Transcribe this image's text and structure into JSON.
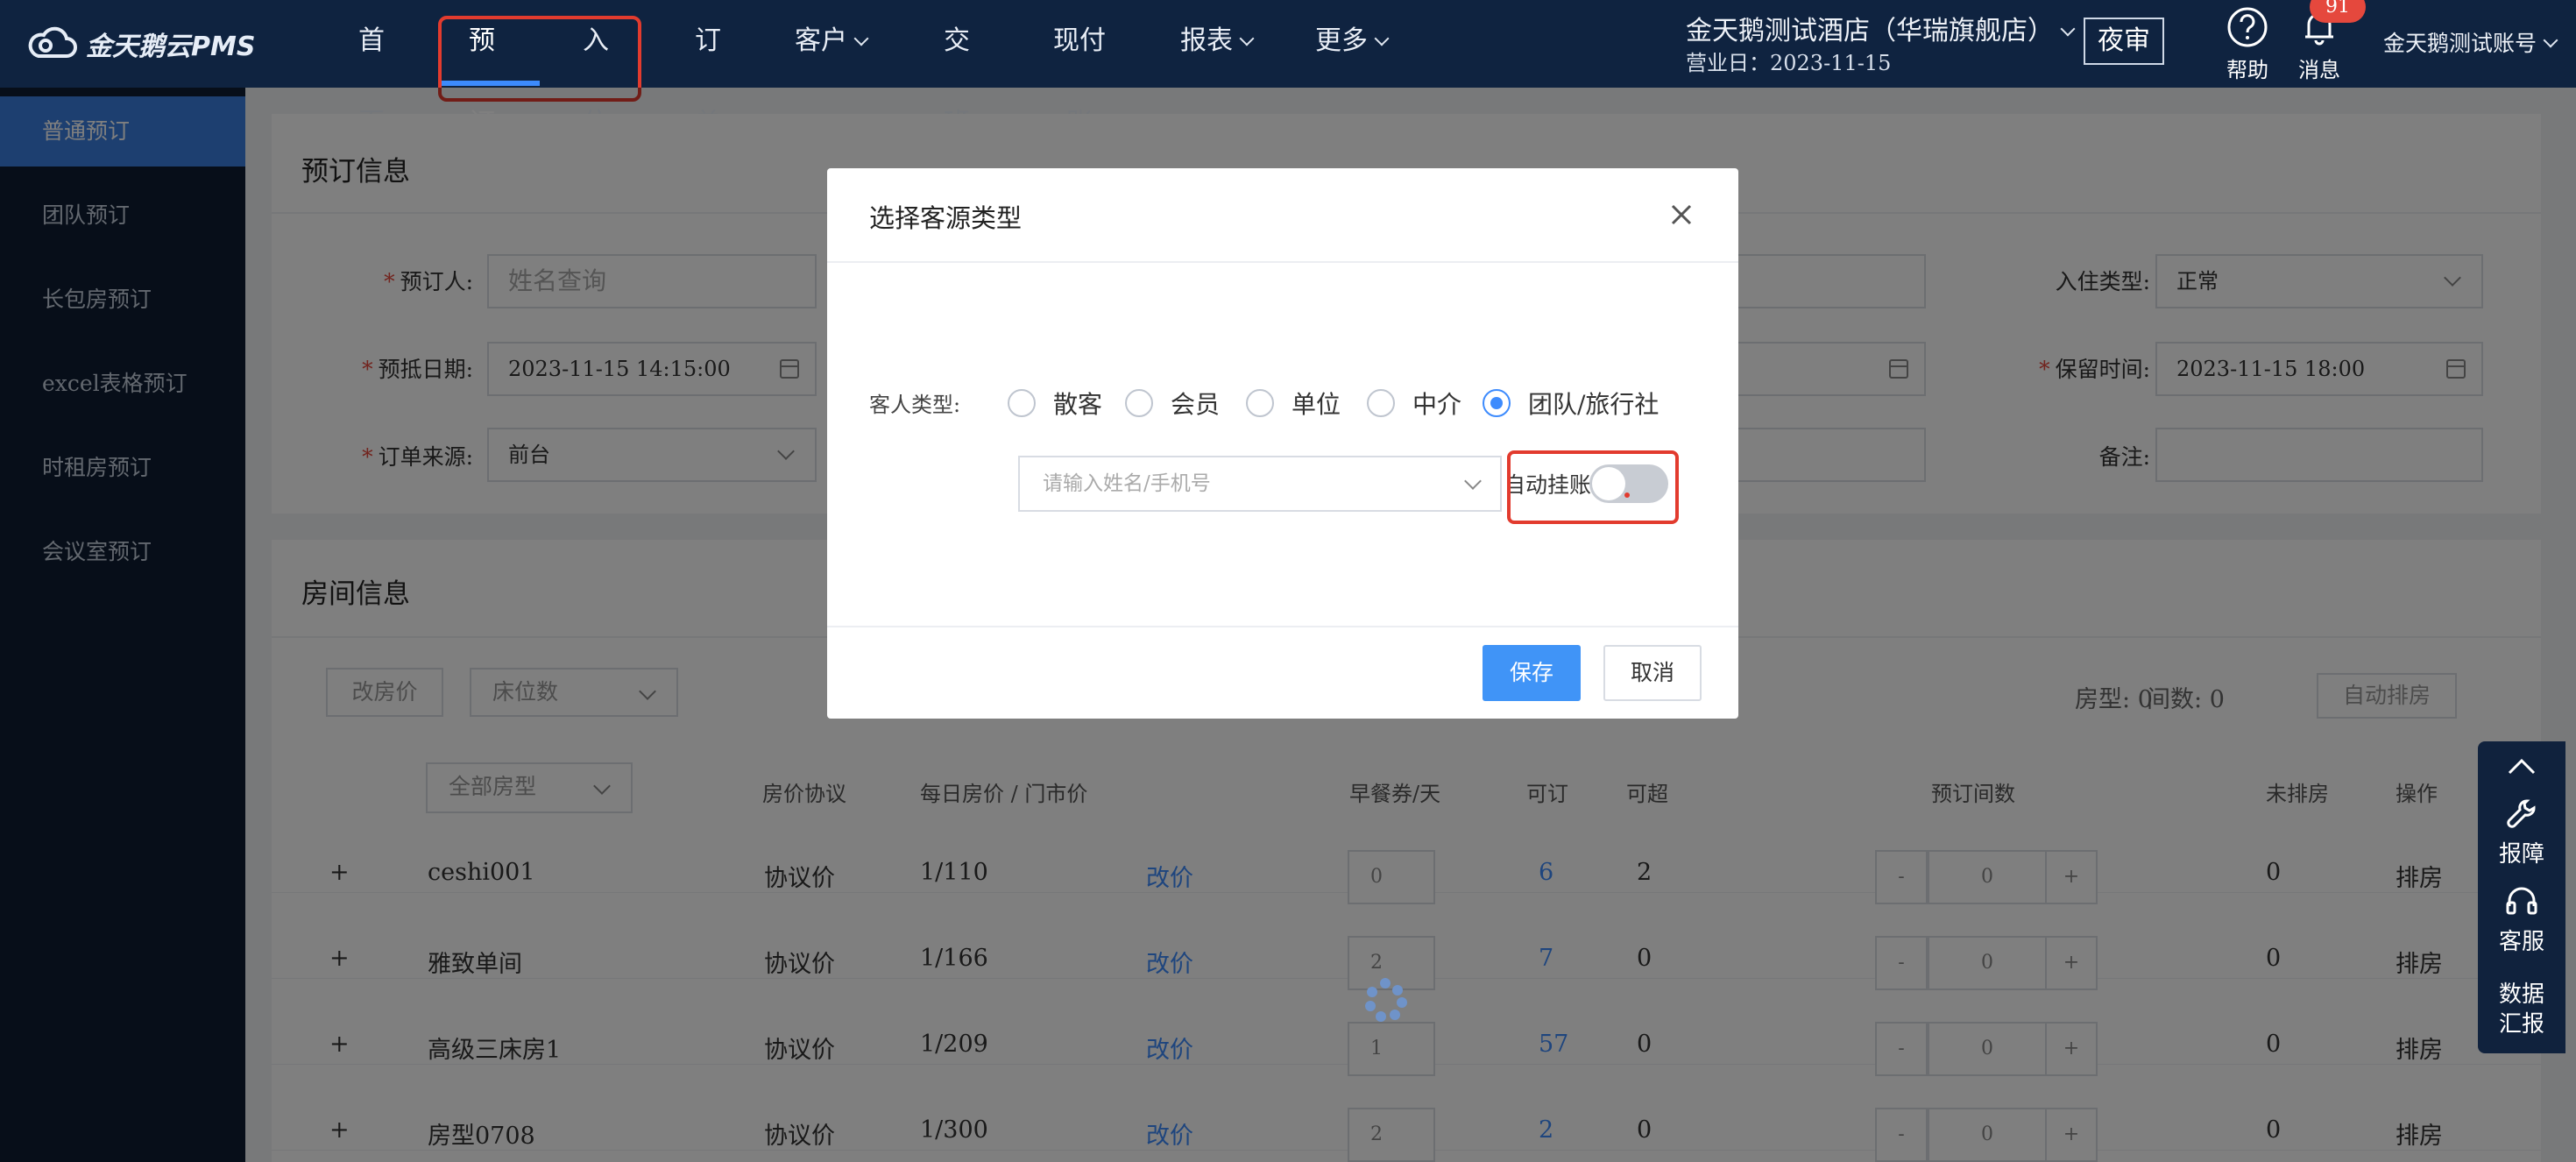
{
  "app": {
    "name": "金天鹅云PMS"
  },
  "nav": {
    "items": [
      {
        "label": "首页"
      },
      {
        "label": "预订"
      },
      {
        "label": "入住"
      },
      {
        "label": "订单"
      },
      {
        "label": "客户"
      },
      {
        "label": "交班"
      },
      {
        "label": "现付账"
      },
      {
        "label": "报表"
      },
      {
        "label": "更多"
      }
    ]
  },
  "header": {
    "hotel": "金天鹅测试酒店（华瑞旗舰店）",
    "business_day": "营业日：2023-11-15",
    "night_audit": "夜审",
    "help": "帮助",
    "messages": "消息",
    "message_count": "91",
    "account": "金天鹅测试账号"
  },
  "sidebar": {
    "items": [
      {
        "label": "普通预订"
      },
      {
        "label": "团队预订"
      },
      {
        "label": "长包房预订"
      },
      {
        "label": "excel表格预订"
      },
      {
        "label": "时租房预订"
      },
      {
        "label": "会议室预订"
      }
    ]
  },
  "booking": {
    "title": "预订信息",
    "booker_label": "预订人:",
    "booker_placeholder": "姓名查询",
    "arrival_label": "预抵日期:",
    "arrival_value": "2023-11-15 14:15:00",
    "source_label": "订单来源:",
    "source_value": "前台",
    "checkin_type_label": "入住类型:",
    "checkin_type_value": "正常",
    "hold_time_label": "保留时间:",
    "hold_time_value": "2023-11-15 18:00",
    "remark_label": "备注:"
  },
  "rooms": {
    "title": "房间信息",
    "change_price": "改房价",
    "bed_count": "床位数",
    "room_type_label": "房型:",
    "room_type_count": "0",
    "room_count_label": "间数:",
    "room_count": "0",
    "auto_assign": "自动排房",
    "all_types": "全部房型",
    "columns": [
      "房价协议",
      "每日房价 / 门市价",
      "早餐券/天",
      "可订",
      "可超",
      "预订间数",
      "未排房",
      "操作"
    ],
    "rows": [
      {
        "expand": "+",
        "name": "ceshi001",
        "protocol": "协议价",
        "price": "1/110",
        "edit": "改价",
        "breakfast": "0",
        "available": "6",
        "overbook": "2",
        "minus": "-",
        "qty": "0",
        "plus": "+",
        "unassigned": "0",
        "action": "排房"
      },
      {
        "expand": "+",
        "name": "雅致单间",
        "protocol": "协议价",
        "price": "1/166",
        "edit": "改价",
        "breakfast": "2",
        "available": "7",
        "overbook": "0",
        "minus": "-",
        "qty": "0",
        "plus": "+",
        "unassigned": "0",
        "action": "排房"
      },
      {
        "expand": "+",
        "name": "高级三床房1",
        "protocol": "协议价",
        "price": "1/209",
        "edit": "改价",
        "breakfast": "1",
        "available": "57",
        "overbook": "0",
        "minus": "-",
        "qty": "0",
        "plus": "+",
        "unassigned": "0",
        "action": "排房"
      },
      {
        "expand": "+",
        "name": "房型0708",
        "protocol": "协议价",
        "price": "1/300",
        "edit": "改价",
        "breakfast": "2",
        "available": "2",
        "overbook": "0",
        "minus": "-",
        "qty": "0",
        "plus": "+",
        "unassigned": "0",
        "action": "排房"
      }
    ]
  },
  "float_tools": {
    "report": "报障",
    "service": "客服",
    "data_line1": "数据",
    "data_line2": "汇报"
  },
  "modal": {
    "title": "选择客源类型",
    "guest_type_label": "客人类型:",
    "options": [
      "散客",
      "会员",
      "单位",
      "中介",
      "团队/旅行社"
    ],
    "selected": "团队/旅行社",
    "search_placeholder": "请输入姓名/手机号",
    "auto_hang_label": "自动挂账",
    "auto_hang_on": false,
    "save": "保存",
    "cancel": "取消"
  },
  "colors": {
    "primary": "#4094f7",
    "nav_bg": "#0f2340",
    "sidebar_bg": "#0e1d33",
    "highlight": "#e23b2e"
  }
}
